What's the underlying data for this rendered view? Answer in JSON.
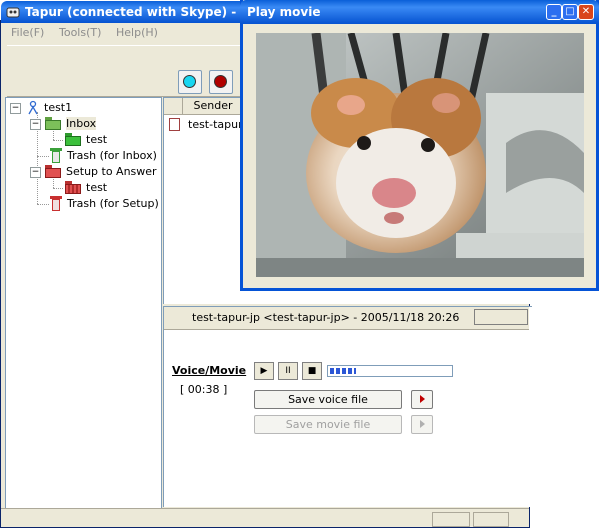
{
  "main_window": {
    "title": "Tapur (connected with Skype) - tes",
    "menu": [
      "File(F)",
      "Tools(T)",
      "Help(H)"
    ],
    "toolbar": {
      "record_cyan_icon": "cyan-circle-icon",
      "record_red_icon": "red-circle-icon"
    },
    "tree": {
      "root": "test1",
      "inbox": "Inbox",
      "inbox_child": "test",
      "trash_inbox": "Trash (for Inbox)",
      "setup": "Setup to Answer",
      "setup_child": "test",
      "trash_setup": "Trash (for Setup)"
    },
    "list": {
      "column_sender": "Sender",
      "rows": [
        {
          "sender": "test-tapur"
        }
      ]
    },
    "detail": {
      "header": "test-tapur-jp <test-tapur-jp> - 2005/11/18 20:26",
      "voice_label": "Voice/Movie",
      "play_symbol": "▶",
      "pause_symbol": "II",
      "stop_symbol": "■",
      "progress": 0.22,
      "duration": "[ 00:38 ]",
      "save_voice": "Save voice file",
      "save_movie": "Save movie file"
    }
  },
  "movie_window": {
    "title": "Play movie",
    "minimize": "_",
    "maximize": "□",
    "close": "✕"
  },
  "colors": {
    "titlebar": "#0a5fd8",
    "window_bg": "#ece9d8",
    "accent_cyan": "#19d6f0",
    "accent_red": "#b00000"
  }
}
